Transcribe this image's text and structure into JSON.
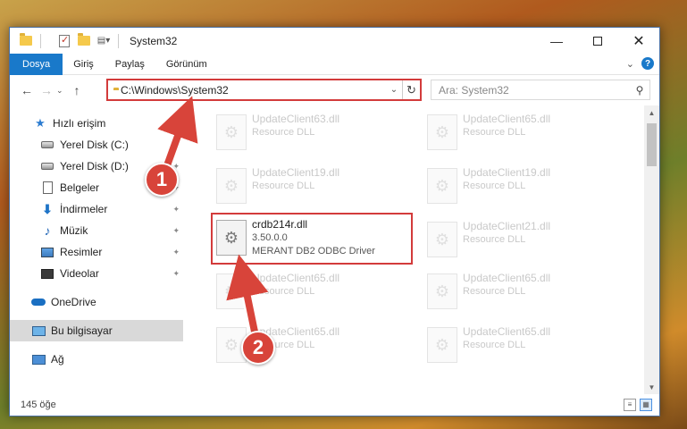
{
  "window": {
    "title": "System32",
    "controls": {
      "minimize": "—",
      "maximize": "",
      "close": "✕"
    }
  },
  "ribbon": {
    "tabs": [
      "Dosya",
      "Giriş",
      "Paylaş",
      "Görünüm"
    ],
    "help": "?"
  },
  "address": {
    "path": "C:\\Windows\\System32",
    "search_placeholder": "Ara: System32"
  },
  "sidebar": {
    "items": [
      {
        "label": "Hızlı erişim",
        "icon": "star-icon"
      },
      {
        "label": "Yerel Disk (C:)",
        "icon": "disk-icon",
        "pinned": true
      },
      {
        "label": "Yerel Disk (D:)",
        "icon": "disk-icon",
        "pinned": true
      },
      {
        "label": "Belgeler",
        "icon": "document-icon",
        "pinned": true
      },
      {
        "label": "İndirmeler",
        "icon": "download-icon",
        "pinned": true
      },
      {
        "label": "Müzik",
        "icon": "music-icon",
        "pinned": true
      },
      {
        "label": "Resimler",
        "icon": "pictures-icon",
        "pinned": true
      },
      {
        "label": "Videolar",
        "icon": "videos-icon",
        "pinned": true
      },
      {
        "label": "OneDrive",
        "icon": "onedrive-icon"
      },
      {
        "label": "Bu bilgisayar",
        "icon": "computer-icon",
        "selected": true
      },
      {
        "label": "Ağ",
        "icon": "network-icon"
      }
    ]
  },
  "files": {
    "left": [
      {
        "name": "UpdateClient63.dll",
        "sub": "Resource DLL"
      },
      {
        "name": "UpdateClient19.dll",
        "sub": "Resource DLL"
      },
      {
        "name": "crdb214r.dll",
        "sub": "3.50.0.0",
        "sub2": "MERANT DB2 ODBC Driver",
        "highlight": true
      },
      {
        "name": "UpdateClient65.dll",
        "sub": "Resource DLL"
      },
      {
        "name": "UpdateClient65.dll",
        "sub": "Resource DLL"
      }
    ],
    "right": [
      {
        "name": "UpdateClient65.dll",
        "sub": "Resource DLL"
      },
      {
        "name": "UpdateClient19.dll",
        "sub": "Resource DLL"
      },
      {
        "name": "UpdateClient21.dll",
        "sub": "Resource DLL"
      },
      {
        "name": "UpdateClient65.dll",
        "sub": "Resource DLL"
      },
      {
        "name": "UpdateClient65.dll",
        "sub": "Resource DLL"
      }
    ]
  },
  "status": {
    "count": "145 öğe"
  },
  "annotations": {
    "badge1": "1",
    "badge2": "2",
    "color": "#d8443a"
  }
}
